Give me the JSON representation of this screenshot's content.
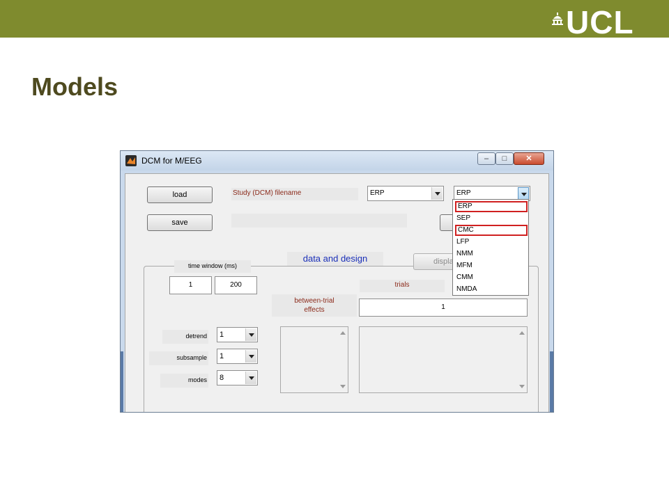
{
  "slide": {
    "title": "Models",
    "logo_text": "UCL",
    "colors": {
      "header": "#7f8b2e",
      "title": "#4e4a1f",
      "highlight_box": "#d02020"
    }
  },
  "window": {
    "title": "DCM for M/EEG",
    "controls": {
      "minimize": "‒",
      "maximize": "□",
      "close": "✕"
    }
  },
  "toolbar": {
    "load_label": "load",
    "save_label": "save",
    "filename_label": "Study (DCM) filename",
    "filename_value": "",
    "model_type_selected": "ERP",
    "model_selected": "ERP",
    "display_label": "displa"
  },
  "model_dropdown": {
    "options": [
      "ERP",
      "SEP",
      "CMC",
      "LFP",
      "NMM",
      "MFM",
      "CMM",
      "NMDA"
    ],
    "highlighted": [
      "ERP",
      "CMC"
    ]
  },
  "design_panel": {
    "heading": "data and design",
    "time_window_label": "time window (ms)",
    "time_start": "1",
    "time_end": "200",
    "trials_label": "trials",
    "trials_value": "1",
    "between_trial_label_1": "between-trial",
    "between_trial_label_2": "effects",
    "detrend_label": "detrend",
    "detrend_value": "1",
    "subsample_label": "subsample",
    "subsample_value": "1",
    "modes_label": "modes",
    "modes_value": "8"
  }
}
